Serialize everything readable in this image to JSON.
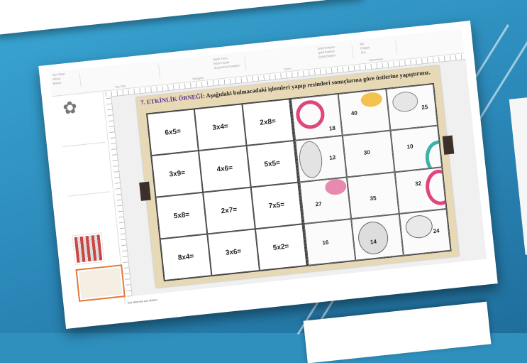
{
  "colors": {
    "background": "#2f8fbd",
    "slide_bg": "#e8d9b6",
    "title_prefix": "#5a2f8a",
    "active_thumb_border": "#e07a3a"
  },
  "ribbon": {
    "labels": [
      "Yeni Slayt",
      "Sıfırla",
      "Bölüm",
      "Yazı Tipi",
      "Paragraf",
      "Çizim",
      "Düzenleme",
      "Metin Yönü",
      "Metni Hizala",
      "SmartArt'a Dönüştür",
      "Şekil Dolgusu",
      "Şekil Anahatı",
      "Şekil Efektleri",
      "Bul",
      "Değiştir",
      "Seç"
    ]
  },
  "thumbnails": [
    {
      "icon": "flower-icon"
    },
    {
      "icon": "blank"
    },
    {
      "icon": "blank"
    },
    {
      "icon": "columns-image"
    },
    {
      "icon": "puzzle-slide",
      "active": true
    }
  ],
  "slide": {
    "title_prefix": "7. ETKİNLİK ÖRNEĞİ:",
    "title_text": " Aşağıdaki bulmacadaki işlemleri yapıp resimleri sonuçlarına göre üstlerine yapıştırınız.",
    "operations": [
      "6x5=",
      "3x4=",
      "2x8=",
      "3x9=",
      "4x6=",
      "5x5=",
      "5x8=",
      "2x7=",
      "7x5=",
      "8x4=",
      "3x6=",
      "5x2="
    ],
    "puzzle_numbers": [
      "18",
      "40",
      "25",
      "12",
      "30",
      "10",
      "27",
      "35",
      "32",
      "16",
      "14",
      "24"
    ]
  },
  "status_bar": {
    "notes_hint": "Not eklemek için tıklatın"
  }
}
